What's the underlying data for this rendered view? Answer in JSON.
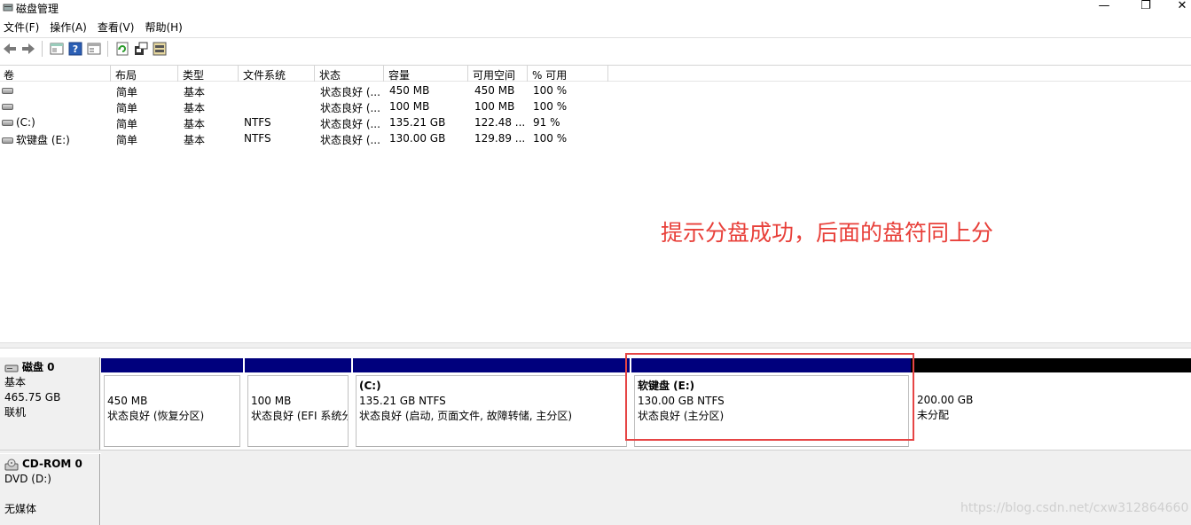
{
  "window": {
    "title": "磁盘管理",
    "minimize": "—",
    "restore": "❐",
    "close": "✕"
  },
  "menu": [
    "文件(F)",
    "操作(A)",
    "查看(V)",
    "帮助(H)"
  ],
  "toolbar": [
    "back-icon",
    "forward-icon",
    "properties-icon",
    "help-icon",
    "console-icon",
    "refresh-icon",
    "settings-icon",
    "disk-icon"
  ],
  "volume_table": {
    "headers": [
      "卷",
      "布局",
      "类型",
      "文件系统",
      "状态",
      "容量",
      "可用空间",
      "% 可用"
    ],
    "rows": [
      [
        "",
        "简单",
        "基本",
        "",
        "状态良好 (...",
        "450 MB",
        "450 MB",
        "100 %"
      ],
      [
        "",
        "简单",
        "基本",
        "",
        "状态良好 (...",
        "100 MB",
        "100 MB",
        "100 %"
      ],
      [
        "(C:)",
        "简单",
        "基本",
        "NTFS",
        "状态良好 (...",
        "135.21 GB",
        "122.48 ...",
        "91 %"
      ],
      [
        "软键盘 (E:)",
        "简单",
        "基本",
        "NTFS",
        "状态良好 (...",
        "130.00 GB",
        "129.89 ...",
        "100 %"
      ]
    ]
  },
  "annotation": "提示分盘成功，后面的盘符同上分",
  "disk0": {
    "name": "磁盘 0",
    "type": "基本",
    "size": "465.75 GB",
    "status": "联机",
    "partitions": [
      {
        "name": "",
        "size": "450 MB",
        "status": "状态良好 (恢复分区)"
      },
      {
        "name": "",
        "size": "100 MB",
        "status": "状态良好 (EFI 系统分"
      },
      {
        "name": "(C:)",
        "size": "135.21 GB NTFS",
        "status": "状态良好 (启动, 页面文件, 故障转储, 主分区)"
      },
      {
        "name": "软键盘  (E:)",
        "size": "130.00 GB NTFS",
        "status": "状态良好 (主分区)"
      },
      {
        "name": "",
        "size": "200.00 GB",
        "status": "未分配"
      }
    ]
  },
  "cdrom0": {
    "name": "CD-ROM 0",
    "drive": "DVD (D:)",
    "media": "无媒体"
  },
  "watermark": "https://blog.csdn.net/cxw312864660",
  "colors": {
    "primary_bar": "#00007d",
    "unallocated_bar": "#000000",
    "annotation": "#e8403a",
    "highlight": "#e64545"
  }
}
